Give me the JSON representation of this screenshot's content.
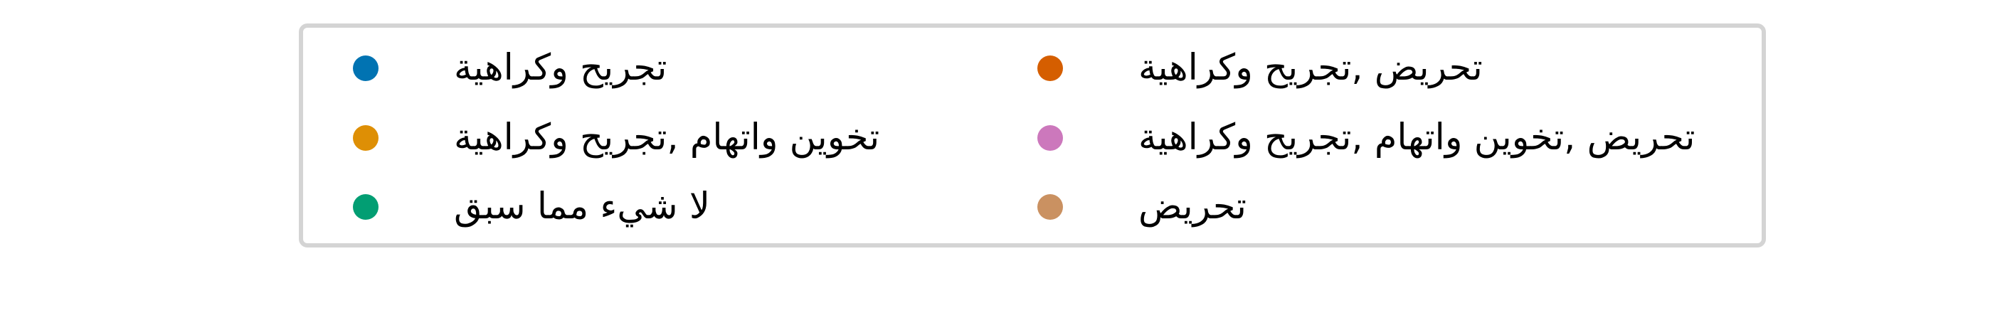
{
  "chart_data": {
    "type": "legend",
    "legend": {
      "placement": "top-center",
      "columns": 2,
      "entries": [
        {
          "label": "تجريح وكراهية",
          "color": "#0173b2"
        },
        {
          "label": "تخوين واتهام ,تجريح وكراهية",
          "color": "#de8f05"
        },
        {
          "label": "لا شيء مما سبق",
          "color": "#029e73"
        },
        {
          "label": "تحريض ,تجريح وكراهية",
          "color": "#d55e00"
        },
        {
          "label": "تحريض ,تخوين واتهام ,تجريح وكراهية",
          "color": "#cc78bc"
        },
        {
          "label": "تحريض",
          "color": "#ca9161"
        }
      ]
    }
  }
}
